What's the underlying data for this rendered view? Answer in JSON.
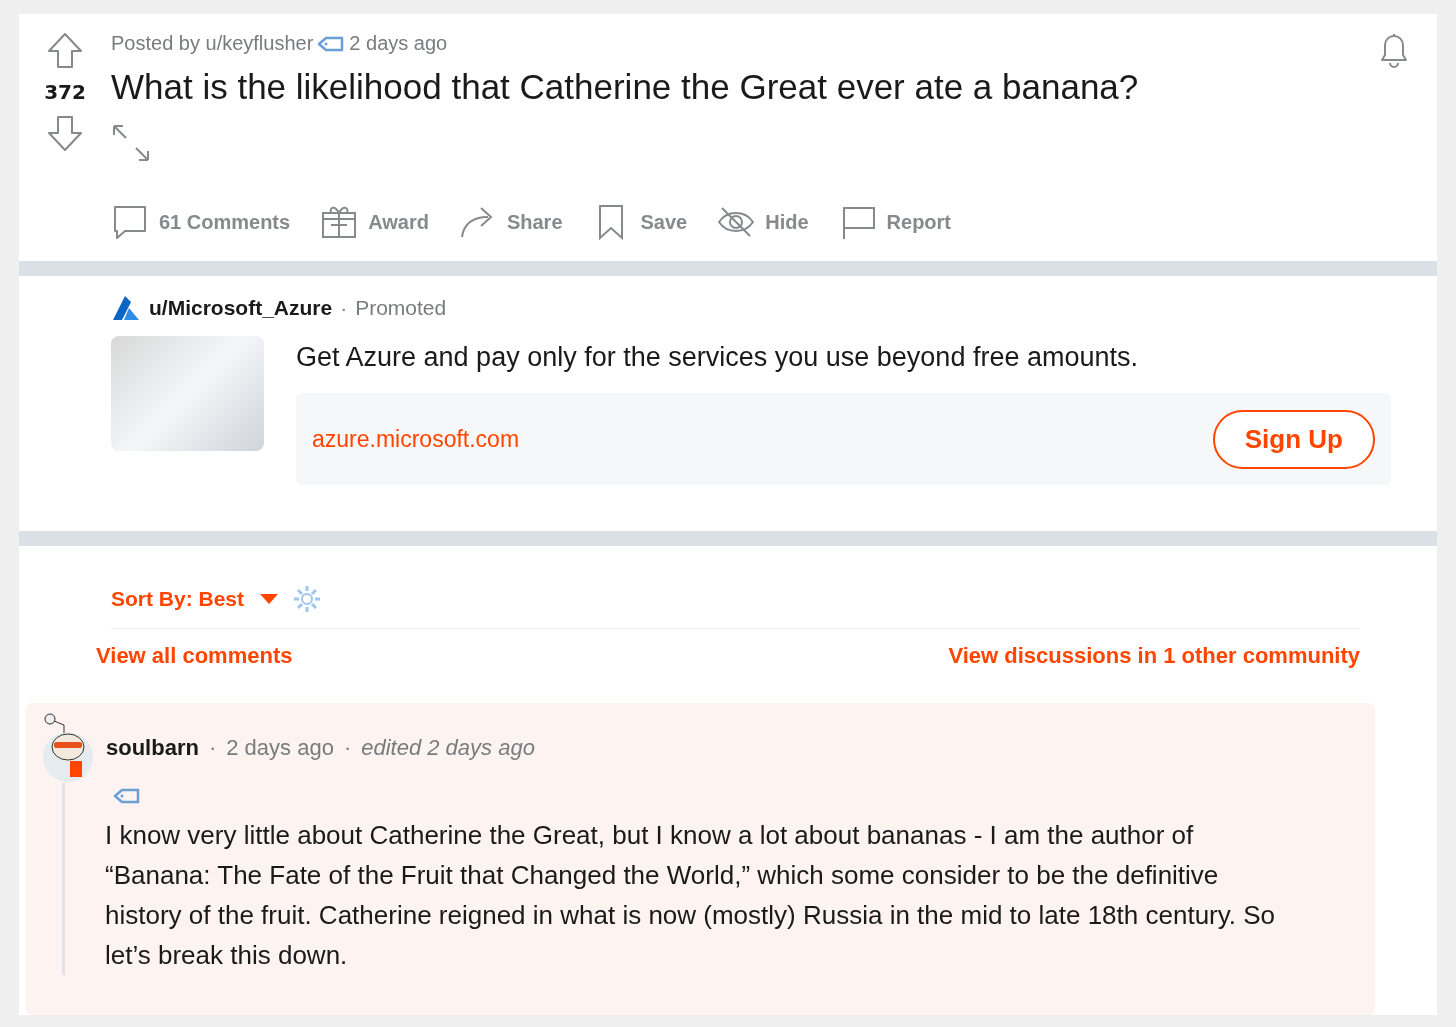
{
  "post": {
    "posted_by": "Posted by u/keyflusher",
    "time": "2 days ago",
    "votes": "372",
    "title": "What is the likelihood that Catherine the Great ever ate a banana?"
  },
  "actions": [
    {
      "kind": "comments",
      "label": "61 Comments"
    },
    {
      "kind": "award",
      "label": "Award"
    },
    {
      "kind": "share",
      "label": "Share"
    },
    {
      "kind": "save",
      "label": "Save"
    },
    {
      "kind": "hide",
      "label": "Hide"
    },
    {
      "kind": "report",
      "label": "Report"
    }
  ],
  "promo": {
    "advertiser": "u/Microsoft_Azure",
    "separator": "·",
    "tag": "Promoted",
    "headline": "Get Azure and pay only for the services you use beyond free amounts.",
    "domain": "azure.microsoft.com",
    "button": "Sign Up"
  },
  "sort": {
    "label": "Sort By: Best"
  },
  "links": {
    "view_all": "View all comments",
    "other": "View discussions in 1 other community"
  },
  "comment": {
    "author": "soulbarn",
    "separator_1": "·",
    "time": "2 days ago",
    "separator_2": "·",
    "edited": "edited 2 days ago",
    "body": "I know very little about Catherine the Great, but I know a lot about bananas - I am the author of “Banana: The Fate of the Fruit that Changed the World,” which some consider to be the definitive history of the fruit. Catherine reigned in what is now (mostly) Russia in the mid to late 18th century. So let’s break this down."
  }
}
